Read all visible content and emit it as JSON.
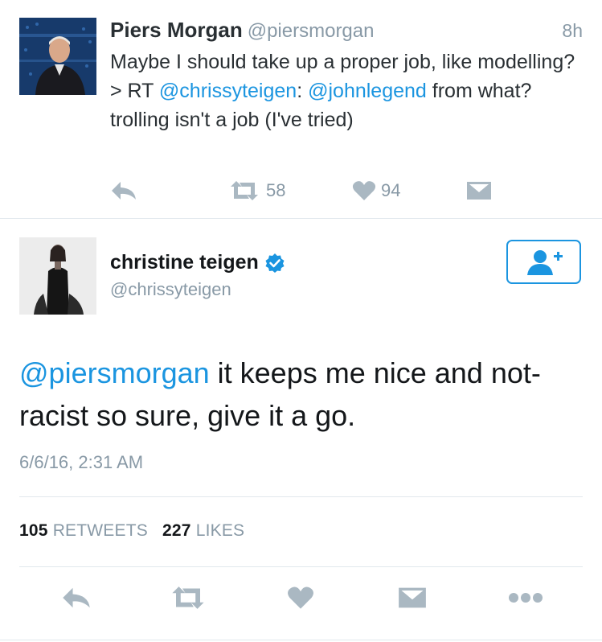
{
  "tweet1": {
    "name": "Piers Morgan",
    "handle": "@piersmorgan",
    "time": "8h",
    "text_part1": "Maybe I should take up a proper job, like modelling? > RT ",
    "mention1": "@chrissyteigen",
    "text_part2": ": ",
    "mention2": "@johnlegend",
    "text_part3": " from what? trolling isn't a job (I've tried)",
    "retweet_count": "58",
    "like_count": "94"
  },
  "tweet2": {
    "name": "christine teigen",
    "handle": "@chrissyteigen",
    "mention": "@piersmorgan",
    "text": " it keeps me nice and not-racist so sure, give it a go.",
    "date": "6/6/16, 2:31 AM",
    "retweets_count": "105",
    "retweets_label": "RETWEETS",
    "likes_count": "227",
    "likes_label": "LIKES"
  },
  "icons": [
    "reply-icon",
    "retweet-icon",
    "heart-icon",
    "message-icon",
    "more-icon",
    "verified-icon",
    "follow-user-icon"
  ],
  "colors": {
    "link": "#1b95e0",
    "muted": "#8899a6",
    "text": "#292f33"
  }
}
